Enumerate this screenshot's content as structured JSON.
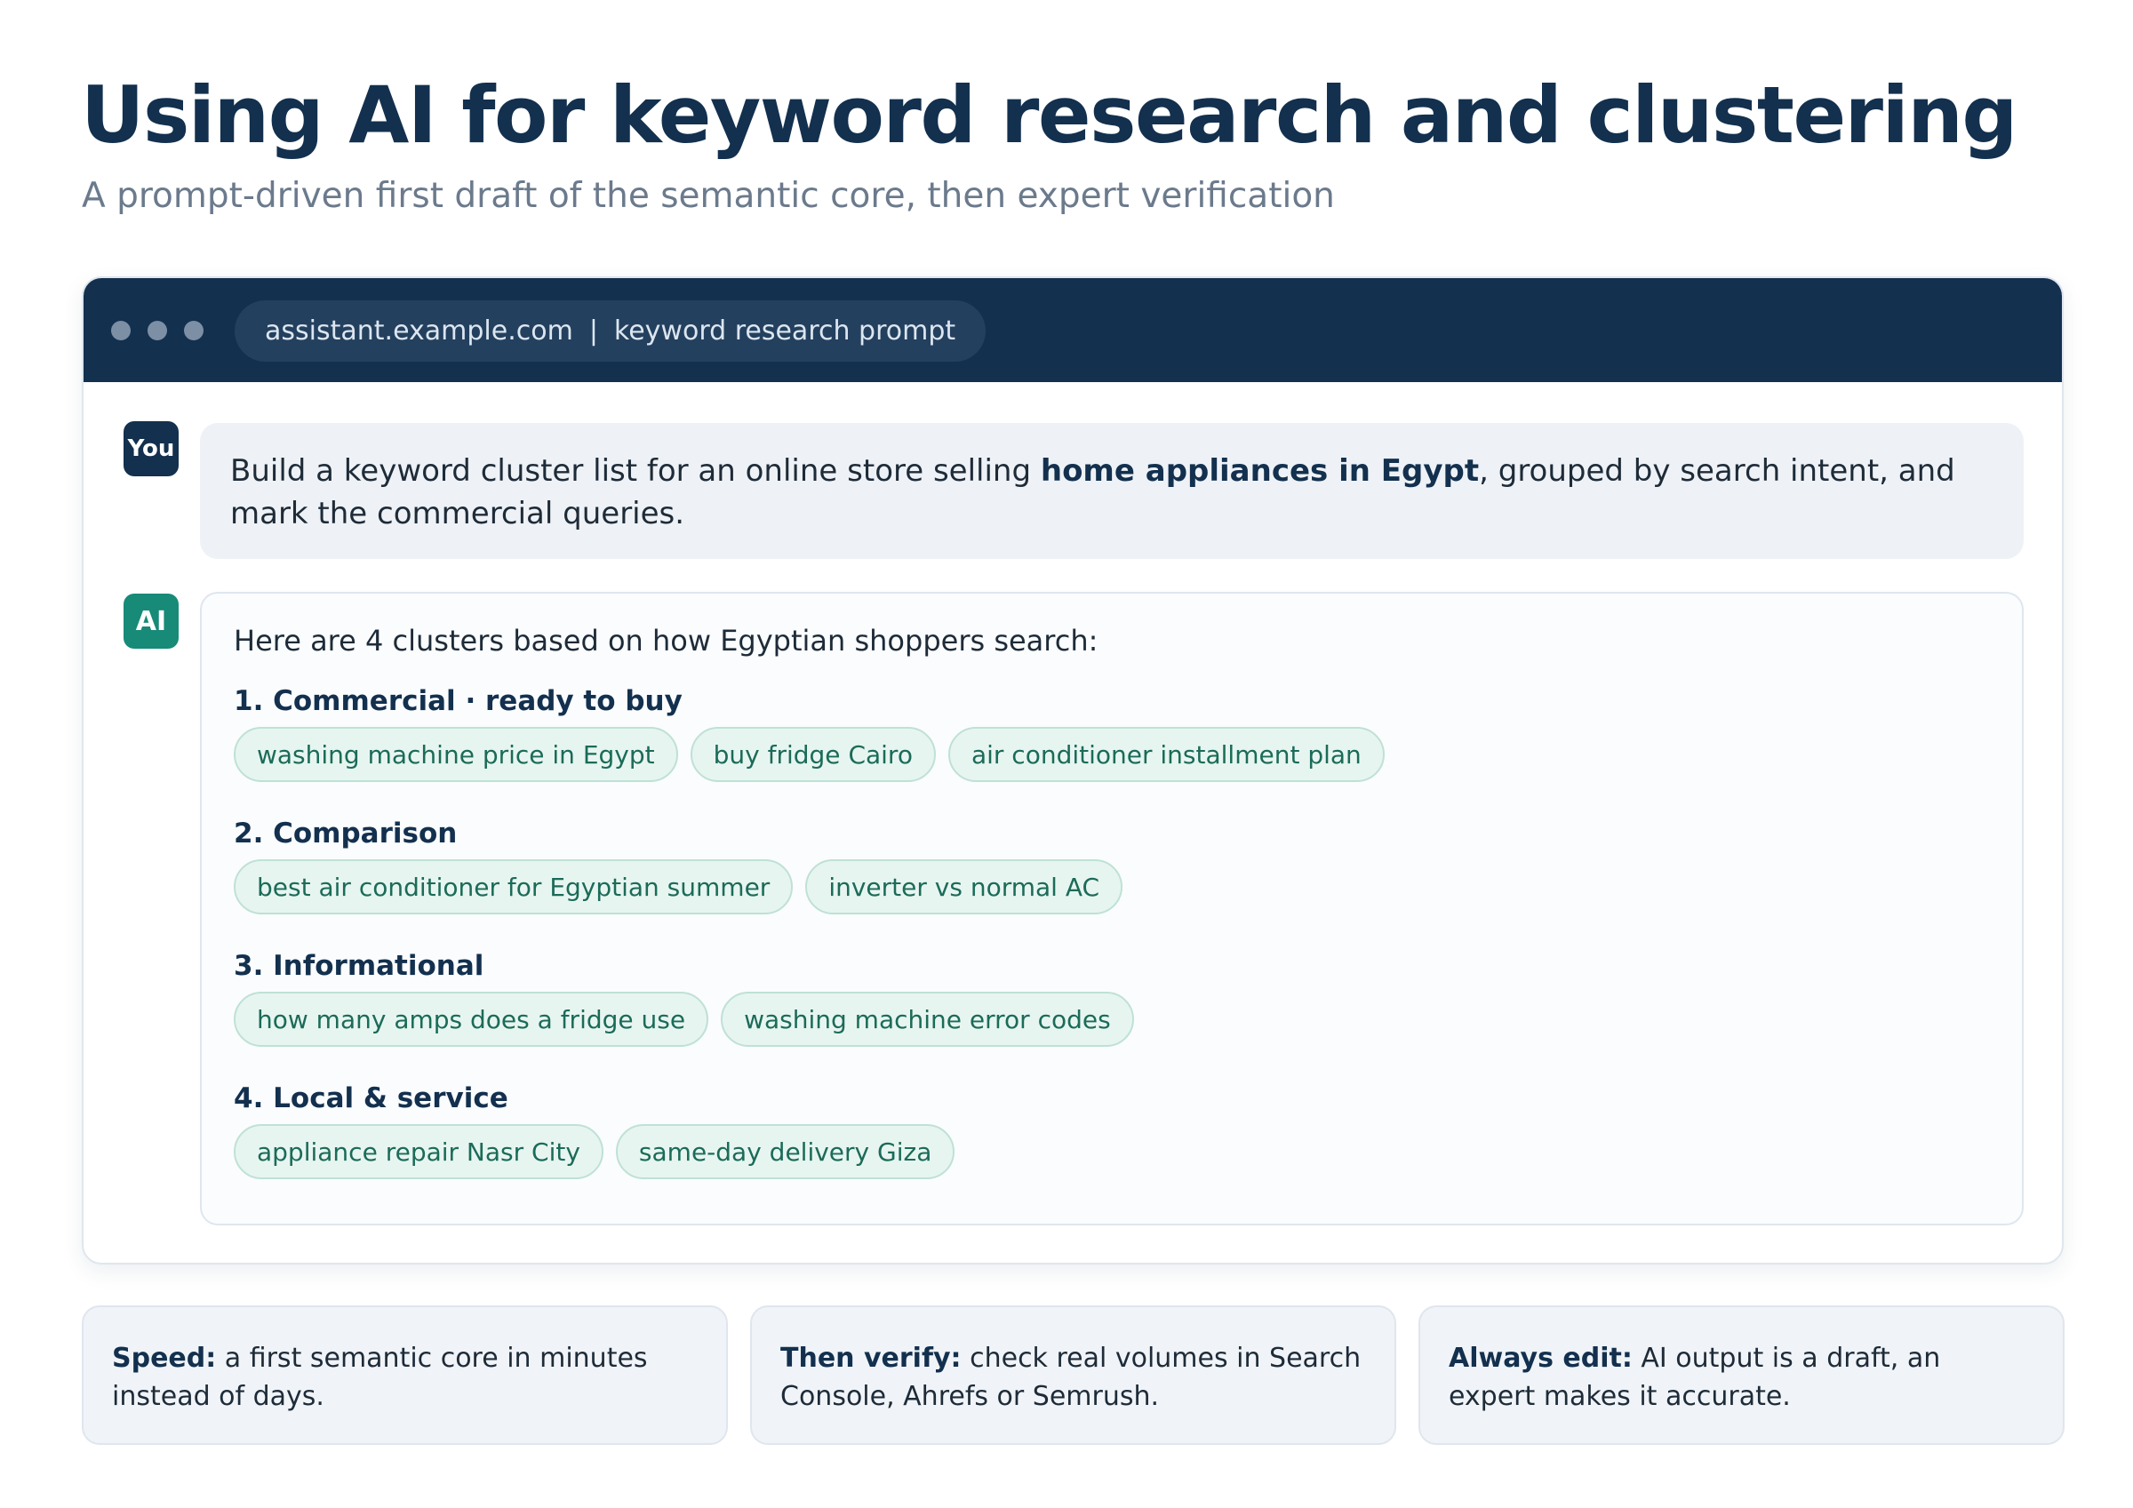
{
  "header": {
    "title": "Using AI for keyword research and clustering",
    "subtitle": "A prompt-driven first draft of the semantic core, then expert verification"
  },
  "browser": {
    "url": "assistant.example.com",
    "separator": "|",
    "page_label": "keyword research prompt"
  },
  "chat": {
    "user": {
      "avatar_label": "You",
      "text_before": "Build a keyword cluster list for an online store selling ",
      "text_bold": "home appliances in Egypt",
      "text_after": ", grouped by search intent, and mark the commercial queries."
    },
    "assistant": {
      "avatar_label": "AI",
      "intro": "Here are 4 clusters based on how Egyptian shoppers search:",
      "clusters": [
        {
          "title": "1. Commercial · ready to buy",
          "keywords": [
            "washing machine price in Egypt",
            "buy fridge Cairo",
            "air conditioner installment plan"
          ]
        },
        {
          "title": "2. Comparison",
          "keywords": [
            "best air conditioner for Egyptian summer",
            "inverter vs normal AC"
          ]
        },
        {
          "title": "3. Informational",
          "keywords": [
            "how many amps does a fridge use",
            "washing machine error codes"
          ]
        },
        {
          "title": "4. Local & service",
          "keywords": [
            "appliance repair Nasr City",
            "same-day delivery Giza"
          ]
        }
      ]
    }
  },
  "notes": [
    {
      "label": "Speed:",
      "text": " a first semantic core in minutes instead of days."
    },
    {
      "label": "Then verify:",
      "text": " check real volumes in Search Console, Ahrefs or Semrush."
    },
    {
      "label": "Always edit:",
      "text": " AI output is a draft, an expert makes it accurate."
    }
  ],
  "colors": {
    "navy": "#13304e",
    "teal": "#178a78",
    "chip_bg": "#e7f5f0",
    "chip_text": "#1b6b58",
    "muted": "#6b7a8c"
  }
}
